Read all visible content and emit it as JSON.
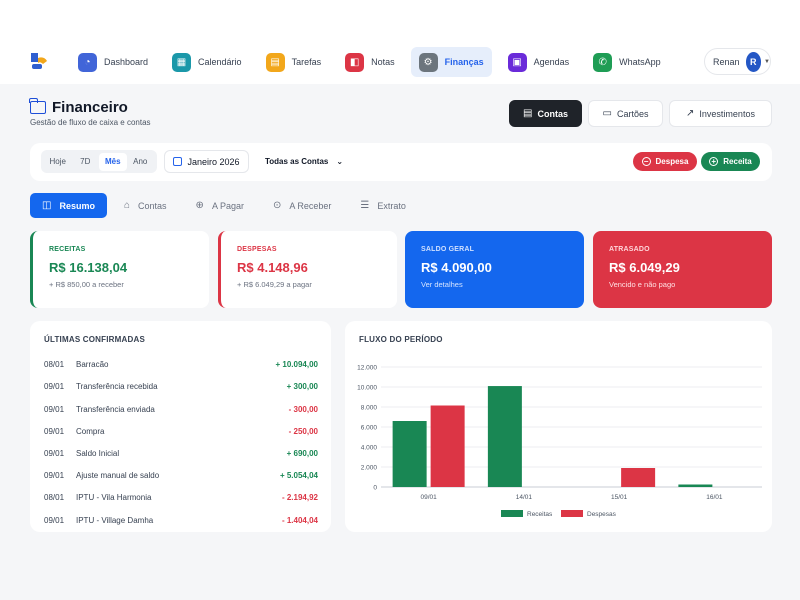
{
  "nav": {
    "items": [
      {
        "label": "Dashboard",
        "icon": "gauge-icon",
        "color": "#4165d8"
      },
      {
        "label": "Calendário",
        "icon": "calendar-icon",
        "color": "#1b98a9"
      },
      {
        "label": "Tarefas",
        "icon": "clipboard-icon",
        "color": "#f2a71b"
      },
      {
        "label": "Notas",
        "icon": "note-icon",
        "color": "#dc3545"
      },
      {
        "label": "Finanças",
        "icon": "finance-icon",
        "color": "#6c757d"
      },
      {
        "label": "Agendas",
        "icon": "agenda-icon",
        "color": "#6a2bd9"
      },
      {
        "label": "WhatsApp",
        "icon": "whatsapp-icon",
        "color": "#1f9d55"
      }
    ],
    "active": "Finanças"
  },
  "user": {
    "name": "Renan",
    "initial": "R"
  },
  "page": {
    "title": "Financeiro",
    "subtitle": "Gestão de fluxo de caixa e contas"
  },
  "view_buttons": {
    "contas": "Contas",
    "cartoes": "Cartões",
    "investimentos": "Investimentos"
  },
  "filters": {
    "ranges": [
      "Hoje",
      "7D",
      "Mês",
      "Ano"
    ],
    "selected_range": "Mês",
    "month": "Janeiro 2026",
    "accounts": "Todas as Contas"
  },
  "actions": {
    "despesa": "Despesa",
    "receita": "Receita"
  },
  "tabs": [
    "Resumo",
    "Contas",
    "A Pagar",
    "A Receber",
    "Extrato"
  ],
  "summary": {
    "receitas": {
      "label": "RECEITAS",
      "value": "R$ 16.138,04",
      "sub": "+ R$ 850,00 a receber"
    },
    "despesas": {
      "label": "DESPESAS",
      "value": "R$ 4.148,96",
      "sub": "+ R$ 6.049,29 a pagar"
    },
    "saldo": {
      "label": "SALDO GERAL",
      "value": "R$ 4.090,00",
      "sub": "Ver detalhes"
    },
    "atrasado": {
      "label": "ATRASADO",
      "value": "R$ 6.049,29",
      "sub": "Vencido e não pago"
    }
  },
  "confirmed": {
    "title": "ÚLTIMAS CONFIRMADAS",
    "rows": [
      {
        "date": "08/01",
        "name": "Barracão",
        "value": "+ 10.094,00",
        "type": "pos"
      },
      {
        "date": "09/01",
        "name": "Transferência recebida",
        "value": "+ 300,00",
        "type": "pos"
      },
      {
        "date": "09/01",
        "name": "Transferência enviada",
        "value": "- 300,00",
        "type": "neg"
      },
      {
        "date": "09/01",
        "name": "Compra",
        "value": "- 250,00",
        "type": "neg"
      },
      {
        "date": "09/01",
        "name": "Saldo Inicial",
        "value": "+ 690,00",
        "type": "pos"
      },
      {
        "date": "09/01",
        "name": "Ajuste manual de saldo",
        "value": "+ 5.054,04",
        "type": "pos"
      },
      {
        "date": "08/01",
        "name": "IPTU - Vila Harmonia",
        "value": "- 2.194,92",
        "type": "neg"
      },
      {
        "date": "09/01",
        "name": "IPTU - Village Damha",
        "value": "- 1.404,04",
        "type": "neg"
      }
    ]
  },
  "flow": {
    "title": "FLUXO DO PERÍODO"
  },
  "colors": {
    "green": "#198754",
    "red": "#dc3545",
    "blue": "#1467ee",
    "dark": "#1f2329"
  },
  "chart_data": {
    "type": "bar",
    "categories": [
      "09/01",
      "14/01",
      "15/01",
      "16/01"
    ],
    "series": [
      {
        "name": "Receitas",
        "values": [
          6600,
          10094,
          0,
          250
        ],
        "color": "#198754"
      },
      {
        "name": "Despesas",
        "values": [
          8150,
          0,
          1900,
          0
        ],
        "color": "#dc3545"
      }
    ],
    "ylim": [
      0,
      12000
    ],
    "yticks": [
      "0",
      "2.000",
      "4.000",
      "6.000",
      "8.000",
      "10.000",
      "12.000"
    ],
    "legend": "bottom",
    "grid": true
  }
}
